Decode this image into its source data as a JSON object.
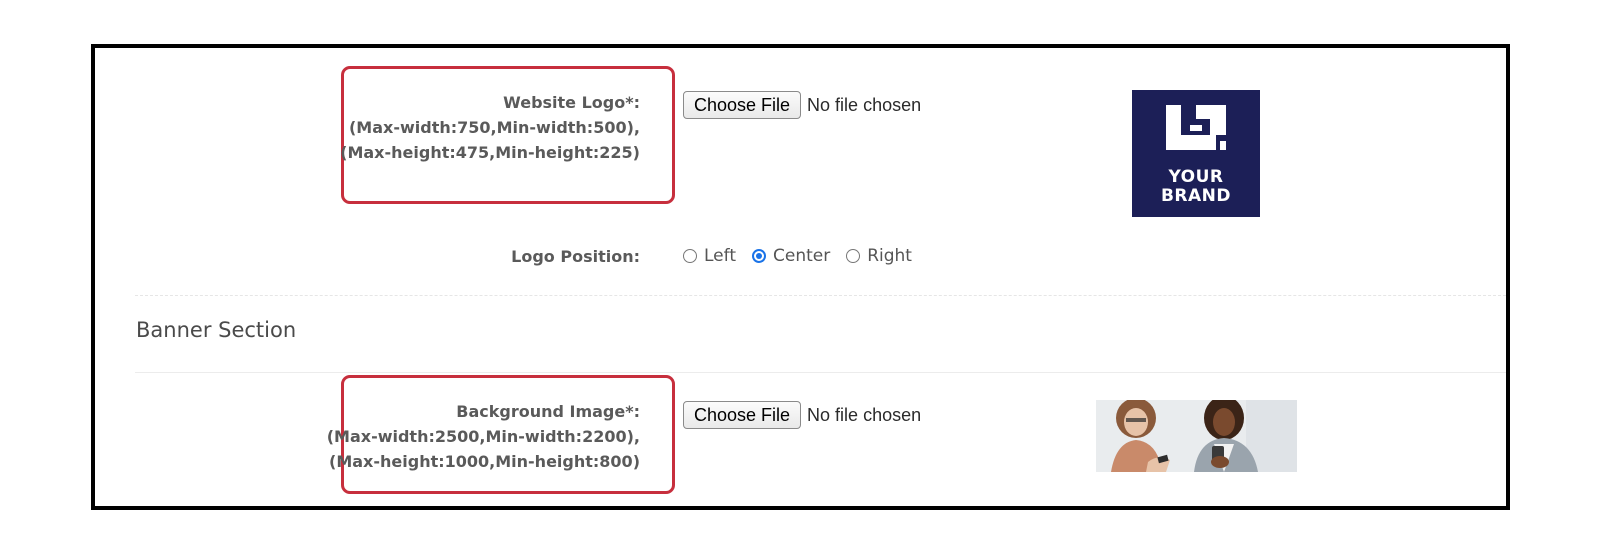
{
  "logo_field": {
    "label_lines": [
      "Website Logo*:",
      "(Max-width:750,Min-width:500),",
      "(Max-height:475,Min-height:225)"
    ],
    "button_label": "Choose File",
    "file_status": "No file chosen",
    "preview_text": [
      "YOUR",
      "BRAND"
    ]
  },
  "logo_position": {
    "label": "Logo Position:",
    "options": [
      "Left",
      "Center",
      "Right"
    ],
    "selected": "Center"
  },
  "banner_section": {
    "title": "Banner Section"
  },
  "background_field": {
    "label_lines": [
      "Background Image*:",
      "(Max-width:2500,Min-width:2200),",
      "(Max-height:1000,Min-height:800)"
    ],
    "button_label": "Choose File",
    "file_status": "No file chosen"
  },
  "colors": {
    "highlight": "#c72f3d",
    "brand_bg": "#1c1f57",
    "radio_accent": "#1a73e8"
  }
}
